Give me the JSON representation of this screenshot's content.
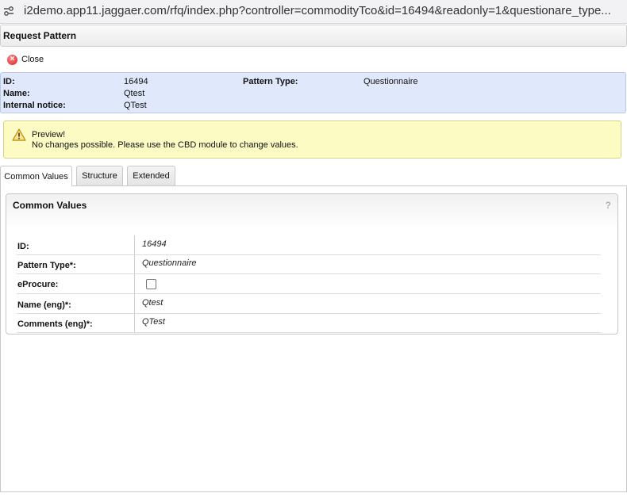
{
  "browser": {
    "url": "i2demo.app11.jaggaer.com/rfq/index.php?controller=commodityTco&id=16494&readonly=1&questionare_type..."
  },
  "window": {
    "title": "Request Pattern"
  },
  "toolbar": {
    "close_label": "Close"
  },
  "info": {
    "id_label": "ID:",
    "id_value": "16494",
    "name_label": "Name:",
    "name_value": "Qtest",
    "notice_label": "Internal notice:",
    "notice_value": "QTest",
    "pattern_type_label": "Pattern Type:",
    "pattern_type_value": "Questionnaire"
  },
  "warning": {
    "title": "Preview!",
    "message": "No changes possible. Please use the CBD module to change values."
  },
  "tabs": [
    {
      "label": "Common Values",
      "active": true
    },
    {
      "label": "Structure",
      "active": false
    },
    {
      "label": "Extended",
      "active": false
    }
  ],
  "common_values": {
    "title": "Common Values",
    "help": "?",
    "rows": [
      {
        "label": "ID:",
        "value": "16494"
      },
      {
        "label": "Pattern Type*:",
        "value": "Questionnaire"
      },
      {
        "label": "eProcure:",
        "checked": false
      },
      {
        "label": "Name (eng)*:",
        "value": "Qtest"
      },
      {
        "label": "Comments (eng)*:",
        "value": "QTest"
      }
    ]
  },
  "colors": {
    "info_bg": "#dfe9fb",
    "warning_bg": "#fcfbc4",
    "close_icon": "#d61f1f"
  },
  "icons": [
    "site-settings-icon",
    "close-icon",
    "warning-icon",
    "help-icon"
  ]
}
